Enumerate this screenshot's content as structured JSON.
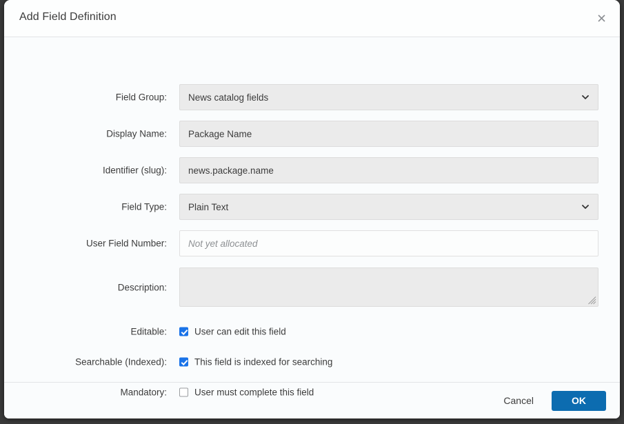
{
  "dialog": {
    "title": "Add Field Definition",
    "close_icon": "close-icon"
  },
  "form": {
    "rows": [
      {
        "label": "Field Group:",
        "value": "News catalog fields"
      },
      {
        "label": "Display Name:",
        "value": "Package Name"
      },
      {
        "label": "Identifier (slug):",
        "value": "news.package.name"
      },
      {
        "label": "Field Type:",
        "value": "Plain Text"
      },
      {
        "label": "User Field Number:",
        "placeholder": "Not yet allocated",
        "value": ""
      },
      {
        "label": "Description:",
        "value": ""
      },
      {
        "label": "Editable:",
        "checkbox_label": "User can edit this field"
      },
      {
        "label": "Searchable (Indexed):",
        "checkbox_label": "This field is indexed for searching"
      },
      {
        "label": "Mandatory:",
        "checkbox_label": "User must complete this field"
      }
    ]
  },
  "footer": {
    "cancel_label": "Cancel",
    "ok_label": "OK"
  },
  "colors": {
    "accent_button": "#0c6cb0",
    "checkbox_checked": "#1a73e8",
    "field_background": "#ebebeb",
    "dialog_background": "#fafcfd"
  }
}
